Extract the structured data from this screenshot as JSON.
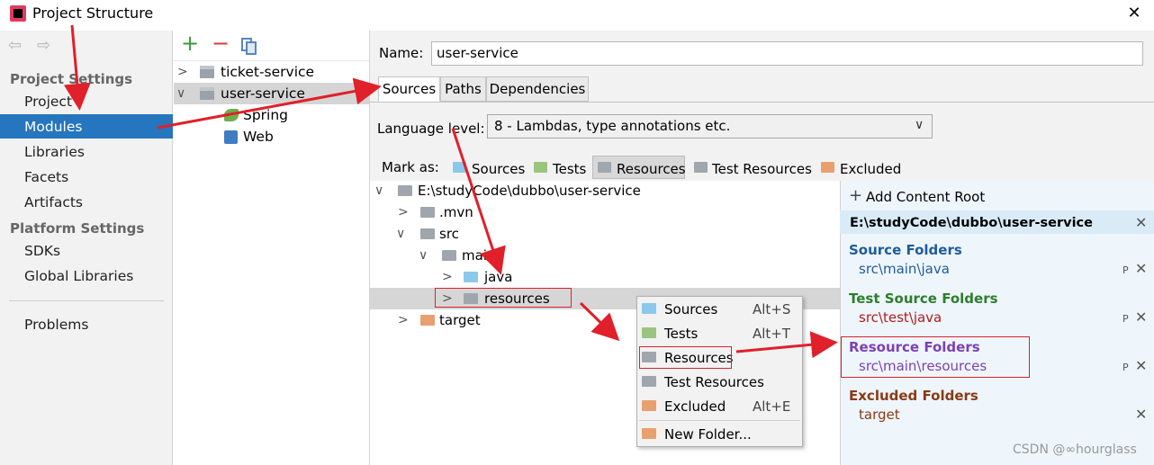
{
  "window": {
    "title": "Project Structure",
    "close_glyph": "✕"
  },
  "nav": {
    "back_glyph": "⇦",
    "forward_glyph": "⇨"
  },
  "sidebar": {
    "project_settings_title": "Project Settings",
    "project_items": [
      "Project",
      "Modules",
      "Libraries",
      "Facets",
      "Artifacts"
    ],
    "selected_item": "Modules",
    "platform_settings_title": "Platform Settings",
    "platform_items": [
      "SDKs",
      "Global Libraries"
    ],
    "problems": "Problems"
  },
  "modules": {
    "toolbar": {
      "add_glyph": "+",
      "remove_glyph": "−"
    },
    "items": [
      {
        "label": "ticket-service",
        "expanded": false
      },
      {
        "label": "user-service",
        "expanded": true,
        "selected": true
      }
    ],
    "facets": [
      "Spring",
      "Web"
    ]
  },
  "module_settings": {
    "name_label": "Name:",
    "name_value": "user-service",
    "tabs": [
      "Sources",
      "Paths",
      "Dependencies"
    ],
    "active_tab": "Sources",
    "language_level_label": "Language level:",
    "language_level_value": "8 - Lambdas, type annotations etc.",
    "mark_as_label": "Mark as:",
    "mark_as_options": [
      {
        "label": "Sources",
        "icon": "sources-folder-icon",
        "color": "#8cc8ec"
      },
      {
        "label": "Tests",
        "icon": "tests-folder-icon",
        "color": "#9bc57e"
      },
      {
        "label": "Resources",
        "icon": "resources-folder-icon",
        "color": "#9fa6ad",
        "active": true
      },
      {
        "label": "Test Resources",
        "icon": "test-resources-folder-icon",
        "color": "#9fa6ad"
      },
      {
        "label": "Excluded",
        "icon": "excluded-folder-icon",
        "color": "#e9a06f"
      }
    ]
  },
  "tree": {
    "root": "E:\\studyCode\\dubbo\\user-service",
    "nodes": [
      ".mvn",
      "src",
      "main",
      "java",
      "resources",
      "target"
    ]
  },
  "content_root": {
    "add_label": "Add Content Root",
    "path": "E:\\studyCode\\dubbo\\user-service",
    "source_folders_title": "Source Folders",
    "source_folder": "src\\main\\java",
    "test_source_folders_title": "Test Source Folders",
    "test_source_folder": "src\\test\\java",
    "resource_folders_title": "Resource Folders",
    "resource_folder": "src\\main\\resources",
    "excluded_folders_title": "Excluded Folders",
    "excluded_folder": "target",
    "colors": {
      "source": "#1f5b9e",
      "test": "#2d7d2d",
      "resource": "#7e3fb5",
      "excluded": "#8a3a14",
      "test_path": "#b31b1b"
    },
    "properties_glyph": "P",
    "remove_glyph": "✕"
  },
  "context_menu": {
    "items": [
      {
        "label": "Sources",
        "shortcut": "Alt+S"
      },
      {
        "label": "Tests",
        "shortcut": "Alt+T"
      },
      {
        "label": "Resources",
        "shortcut": ""
      },
      {
        "label": "Test Resources",
        "shortcut": ""
      },
      {
        "label": "Excluded",
        "shortcut": "Alt+E"
      },
      {
        "label": "New Folder...",
        "shortcut": ""
      }
    ]
  },
  "watermark": "CSDN @∞hourglass",
  "annotation_color": "#e0202a"
}
